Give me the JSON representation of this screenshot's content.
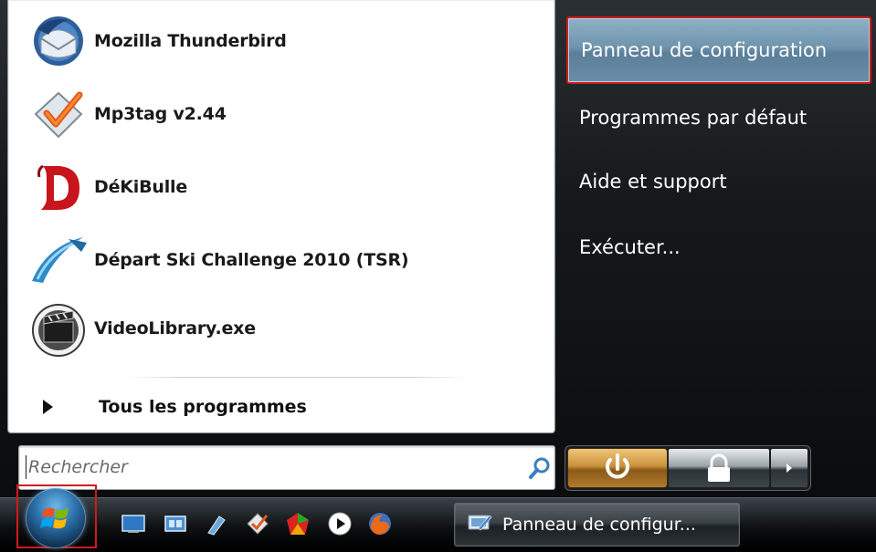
{
  "start_menu": {
    "programs": [
      {
        "label": "Mozilla Thunderbird",
        "icon": "thunderbird-icon"
      },
      {
        "label": "Mp3tag v2.44",
        "icon": "mp3tag-icon"
      },
      {
        "label": "DéKiBulle",
        "icon": "dekibulle-icon"
      },
      {
        "label": "Départ Ski Challenge 2010 (TSR)",
        "icon": "ski-challenge-icon"
      },
      {
        "label": "VideoLibrary.exe",
        "icon": "video-library-icon"
      }
    ],
    "all_programs_label": "Tous les programmes",
    "search": {
      "placeholder": "Rechercher",
      "value": ""
    },
    "right_items": [
      {
        "label": "Panneau de configuration",
        "selected": true
      },
      {
        "label": "Programmes par défaut",
        "selected": false
      },
      {
        "label": "Aide et support",
        "selected": false
      },
      {
        "label": "Exécuter...",
        "selected": false
      }
    ]
  },
  "taskbar": {
    "quick_launch": [
      "show-desktop-icon",
      "switch-windows-icon",
      "tool-icon",
      "mp3tag-icon",
      "colorful-app-icon",
      "media-player-icon",
      "firefox-icon"
    ],
    "active_task": {
      "label": "Panneau de configur...",
      "icon": "control-panel-icon"
    }
  },
  "colors": {
    "highlight_border": "#d11a1a",
    "selected_item_bg": "#6f94ad",
    "power_button": "#c9913c"
  }
}
